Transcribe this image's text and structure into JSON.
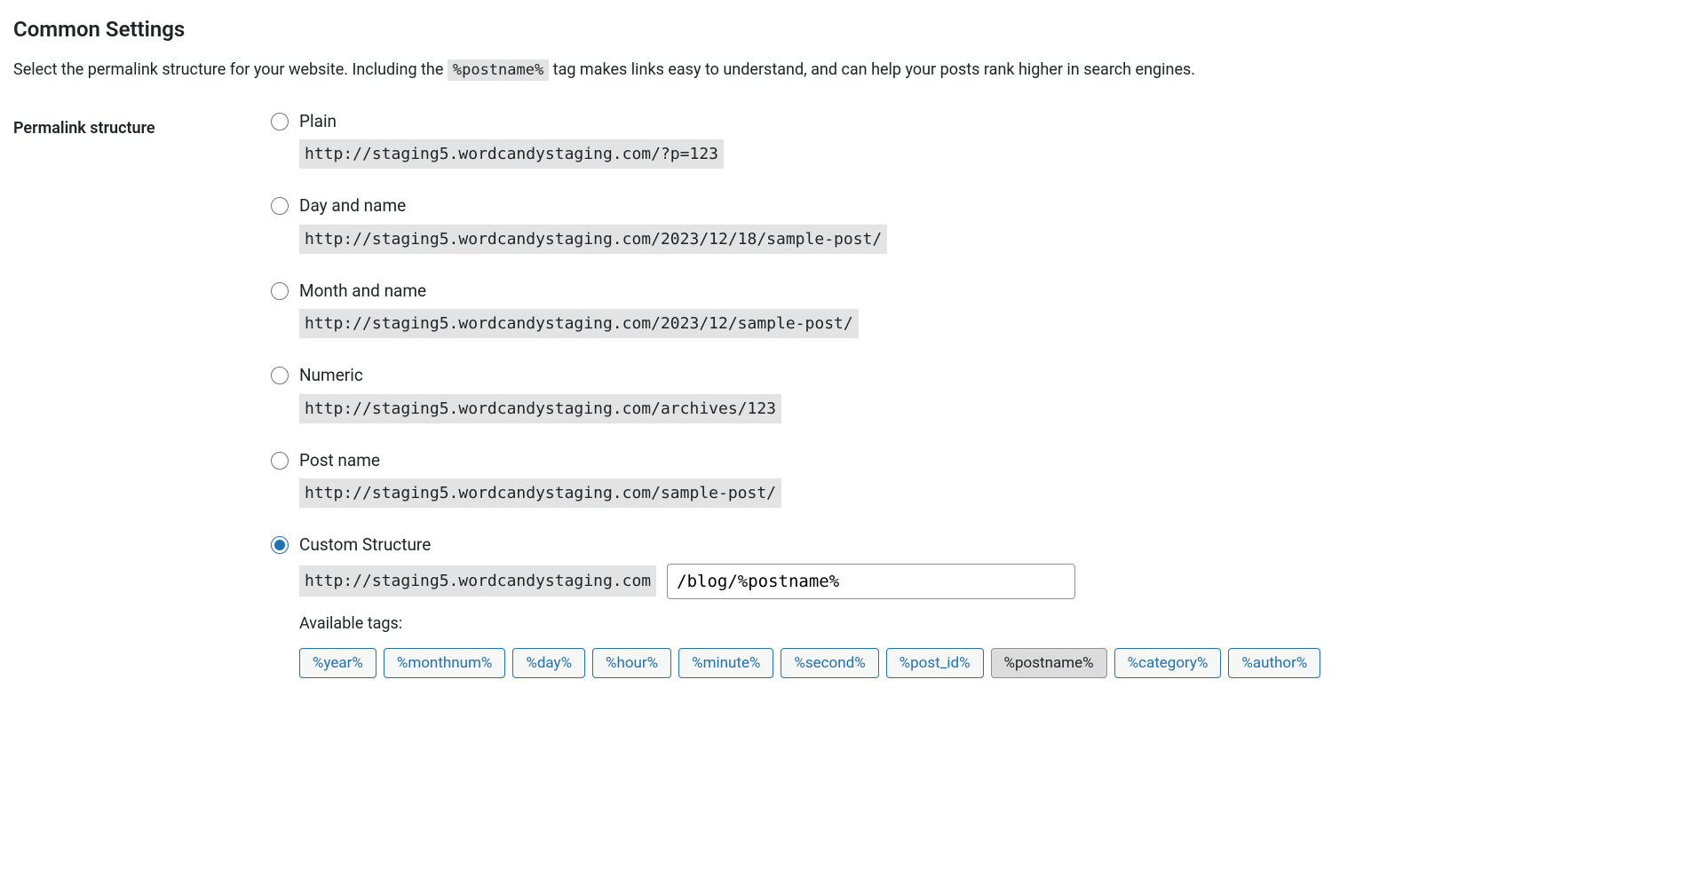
{
  "heading": "Common Settings",
  "description": {
    "part1": "Select the permalink structure for your website. Including the ",
    "code": "%postname%",
    "part2": " tag makes links easy to understand, and can help your posts rank higher in search engines."
  },
  "form": {
    "label": "Permalink structure",
    "options": [
      {
        "id": "plain",
        "label": "Plain",
        "url": "http://staging5.wordcandystaging.com/?p=123",
        "checked": false
      },
      {
        "id": "day-name",
        "label": "Day and name",
        "url": "http://staging5.wordcandystaging.com/2023/12/18/sample-post/",
        "checked": false
      },
      {
        "id": "month-name",
        "label": "Month and name",
        "url": "http://staging5.wordcandystaging.com/2023/12/sample-post/",
        "checked": false
      },
      {
        "id": "numeric",
        "label": "Numeric",
        "url": "http://staging5.wordcandystaging.com/archives/123",
        "checked": false
      },
      {
        "id": "post-name",
        "label": "Post name",
        "url": "http://staging5.wordcandystaging.com/sample-post/",
        "checked": false
      }
    ],
    "custom": {
      "label": "Custom Structure",
      "prefix": "http://staging5.wordcandystaging.com",
      "value": "/blog/%postname%",
      "checked": true
    },
    "tags_label": "Available tags:",
    "tags": [
      {
        "text": "%year%",
        "active": false
      },
      {
        "text": "%monthnum%",
        "active": false
      },
      {
        "text": "%day%",
        "active": false
      },
      {
        "text": "%hour%",
        "active": false
      },
      {
        "text": "%minute%",
        "active": false
      },
      {
        "text": "%second%",
        "active": false
      },
      {
        "text": "%post_id%",
        "active": false
      },
      {
        "text": "%postname%",
        "active": true
      },
      {
        "text": "%category%",
        "active": false
      },
      {
        "text": "%author%",
        "active": false
      }
    ]
  }
}
